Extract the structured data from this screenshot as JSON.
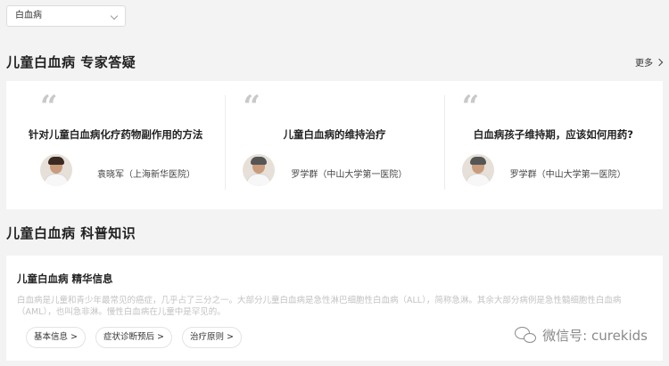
{
  "filter": {
    "selected": "白血病"
  },
  "qa_section": {
    "title": "儿童白血病 专家答疑",
    "more_label": "更多",
    "cards": [
      {
        "title": "针对儿童白血病化疗药物副作用的方法",
        "doctor": "袁晓军（上海新华医院）"
      },
      {
        "title": "儿童白血病的维持治疗",
        "doctor": "罗学群（中山大学第一医院）"
      },
      {
        "title": "白血病孩子维持期，应该如何用药?",
        "doctor": "罗学群（中山大学第一医院）"
      }
    ]
  },
  "science_section": {
    "title": "儿童白血病 科普知识",
    "card_heading": "儿童白血病 精华信息",
    "card_text": "白血病是儿童和青少年最常见的癌症，几乎占了三分之一。大部分儿童白血病是急性淋巴细胞性白血病（ALL），简称急淋。其余大部分病例是急性髓细胞性白血病（AML），也叫急非淋。慢性白血病在儿童中是罕见的。",
    "tags": [
      "基本信息 >",
      "症状诊断预后 >",
      "治疗原则 >"
    ]
  },
  "watermark": {
    "text": "微信号: curekids"
  }
}
